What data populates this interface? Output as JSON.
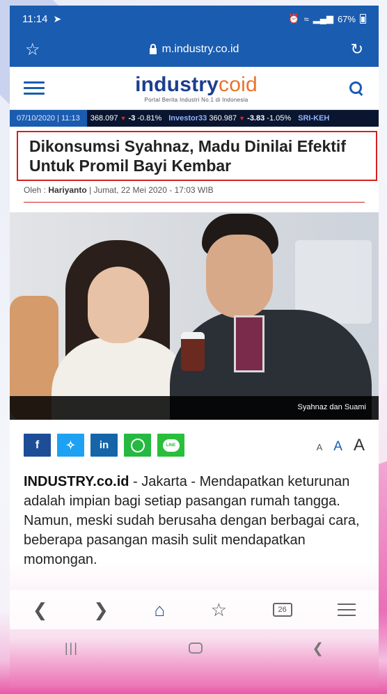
{
  "status_bar": {
    "time": "11:14",
    "battery": "67%"
  },
  "address_bar": {
    "url": "m.industry.co.id"
  },
  "site": {
    "logo_main": "industry",
    "logo_ext": "coid",
    "tagline": "Portal Berita Industri No.1 di Indonesia"
  },
  "ticker": {
    "date": "07/10/2020 | 11:13",
    "items": [
      {
        "value": "368.097",
        "change": "-3",
        "pct": "-0.81%"
      },
      {
        "index": "Investor33",
        "value": "360.987",
        "change": "-3.83",
        "pct": "-1.05%"
      },
      {
        "index": "SRI-KEH"
      }
    ]
  },
  "article": {
    "headline": "Dikonsumsi Syahnaz, Madu Dinilai Efektif Untuk Promil Bayi Kembar",
    "byline_prefix": "Oleh :",
    "author": "Hariyanto",
    "date": "| Jumat, 22 Mei 2020 - 17:03 WIB",
    "image_caption": "Syahnaz dan Suami",
    "lead_source": "INDUSTRY.co.id",
    "lead_text": " - Jakarta - Mendapatkan keturunan adalah impian bagi setiap pasangan rumah tangga. Namun, meski sudah berusaha dengan berbagai cara, beberapa pasangan masih sulit mendapatkan momongan."
  },
  "share": {
    "facebook": "f",
    "twitter": "t",
    "linkedin": "in",
    "line": "LINE"
  },
  "font_size": {
    "small": "A",
    "medium": "A",
    "large": "A"
  },
  "browser_toolbar": {
    "tab_count": "26"
  },
  "colors": {
    "brand_blue": "#1a5cb0",
    "logo_navy": "#1b3e8f",
    "logo_orange": "#e8732b",
    "highlight_red": "#d61f1f"
  }
}
